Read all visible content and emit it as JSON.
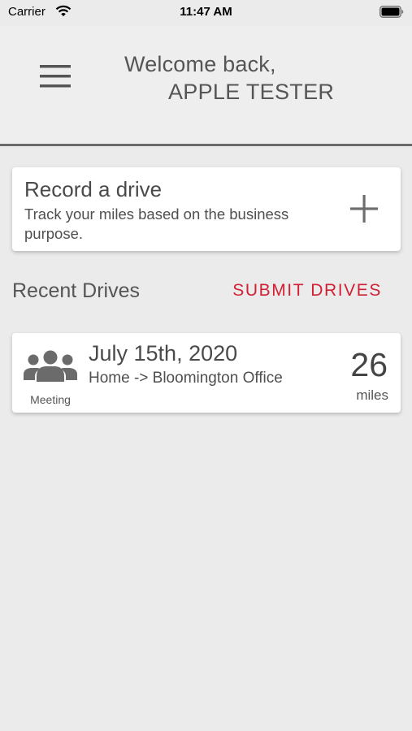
{
  "status_bar": {
    "carrier": "Carrier",
    "time": "11:47 AM"
  },
  "header": {
    "greeting": "Welcome back,",
    "user_name": "APPLE TESTER"
  },
  "record_card": {
    "title": "Record a drive",
    "subtitle": "Track your miles based on the business purpose."
  },
  "recent": {
    "title": "Recent Drives",
    "submit_label": "SUBMIT DRIVES"
  },
  "drives": [
    {
      "date": "July 15th, 2020",
      "route": "Home -> Bloomington Office",
      "purpose": "Meeting",
      "miles": "26",
      "miles_unit": "miles",
      "icon": "group-icon"
    }
  ],
  "colors": {
    "accent": "#d11f33",
    "background": "#ebebeb",
    "card": "#ffffff",
    "divider": "#6a6a6a"
  }
}
